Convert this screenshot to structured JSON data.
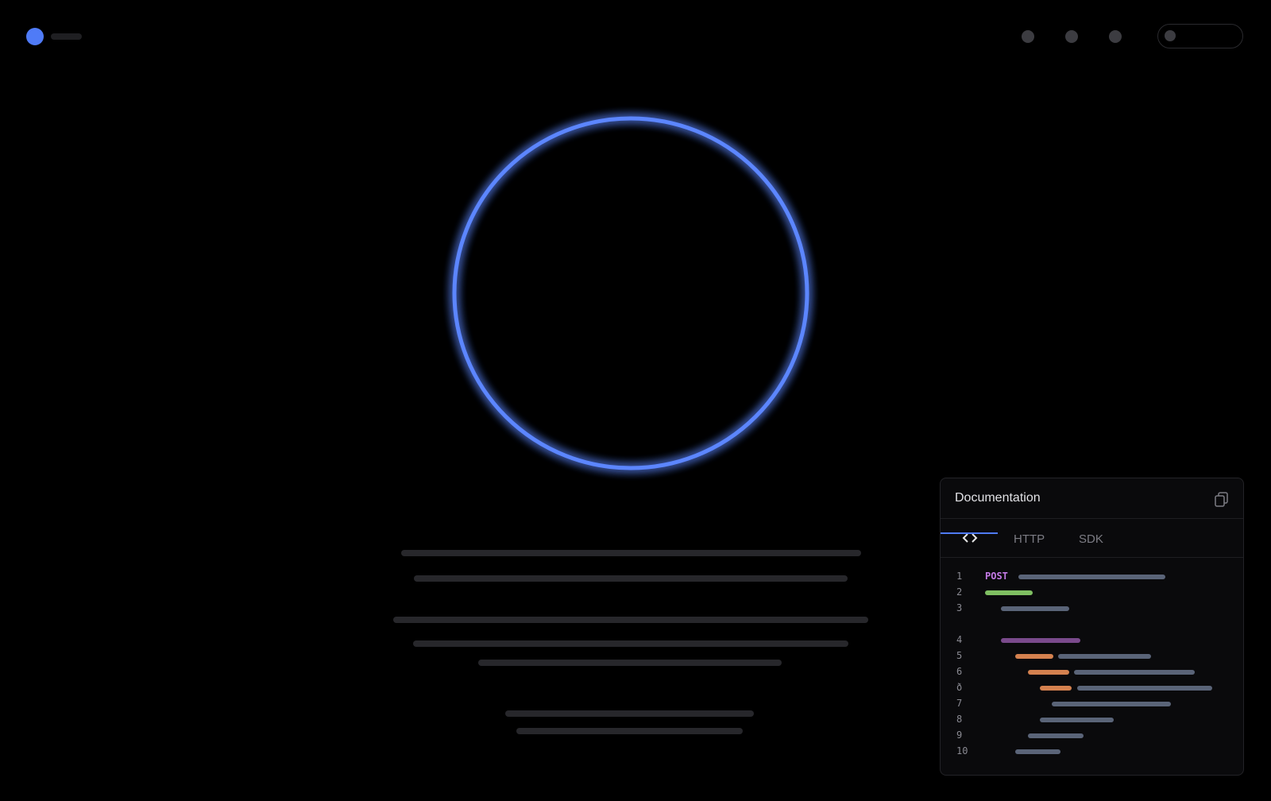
{
  "panel": {
    "title": "Documentation",
    "tabs": [
      {
        "label": "<>",
        "icon": "code-brackets-icon",
        "active": true
      },
      {
        "label": "HTTP",
        "active": false
      },
      {
        "label": "SDK",
        "active": false
      }
    ],
    "line_numbers": [
      "1",
      "2",
      "3",
      "4",
      "5",
      "6",
      "ð",
      "7",
      "8",
      "9",
      "10"
    ],
    "keyword": "POST"
  },
  "colors": {
    "accent": "#4f7bf7",
    "ring": "#5b86ff",
    "keyword": "#c47ae6",
    "token_default": "#5a6478",
    "token_green": "#7fbf62",
    "token_orange": "#d4814f",
    "token_purple": "#7a4a8c"
  }
}
